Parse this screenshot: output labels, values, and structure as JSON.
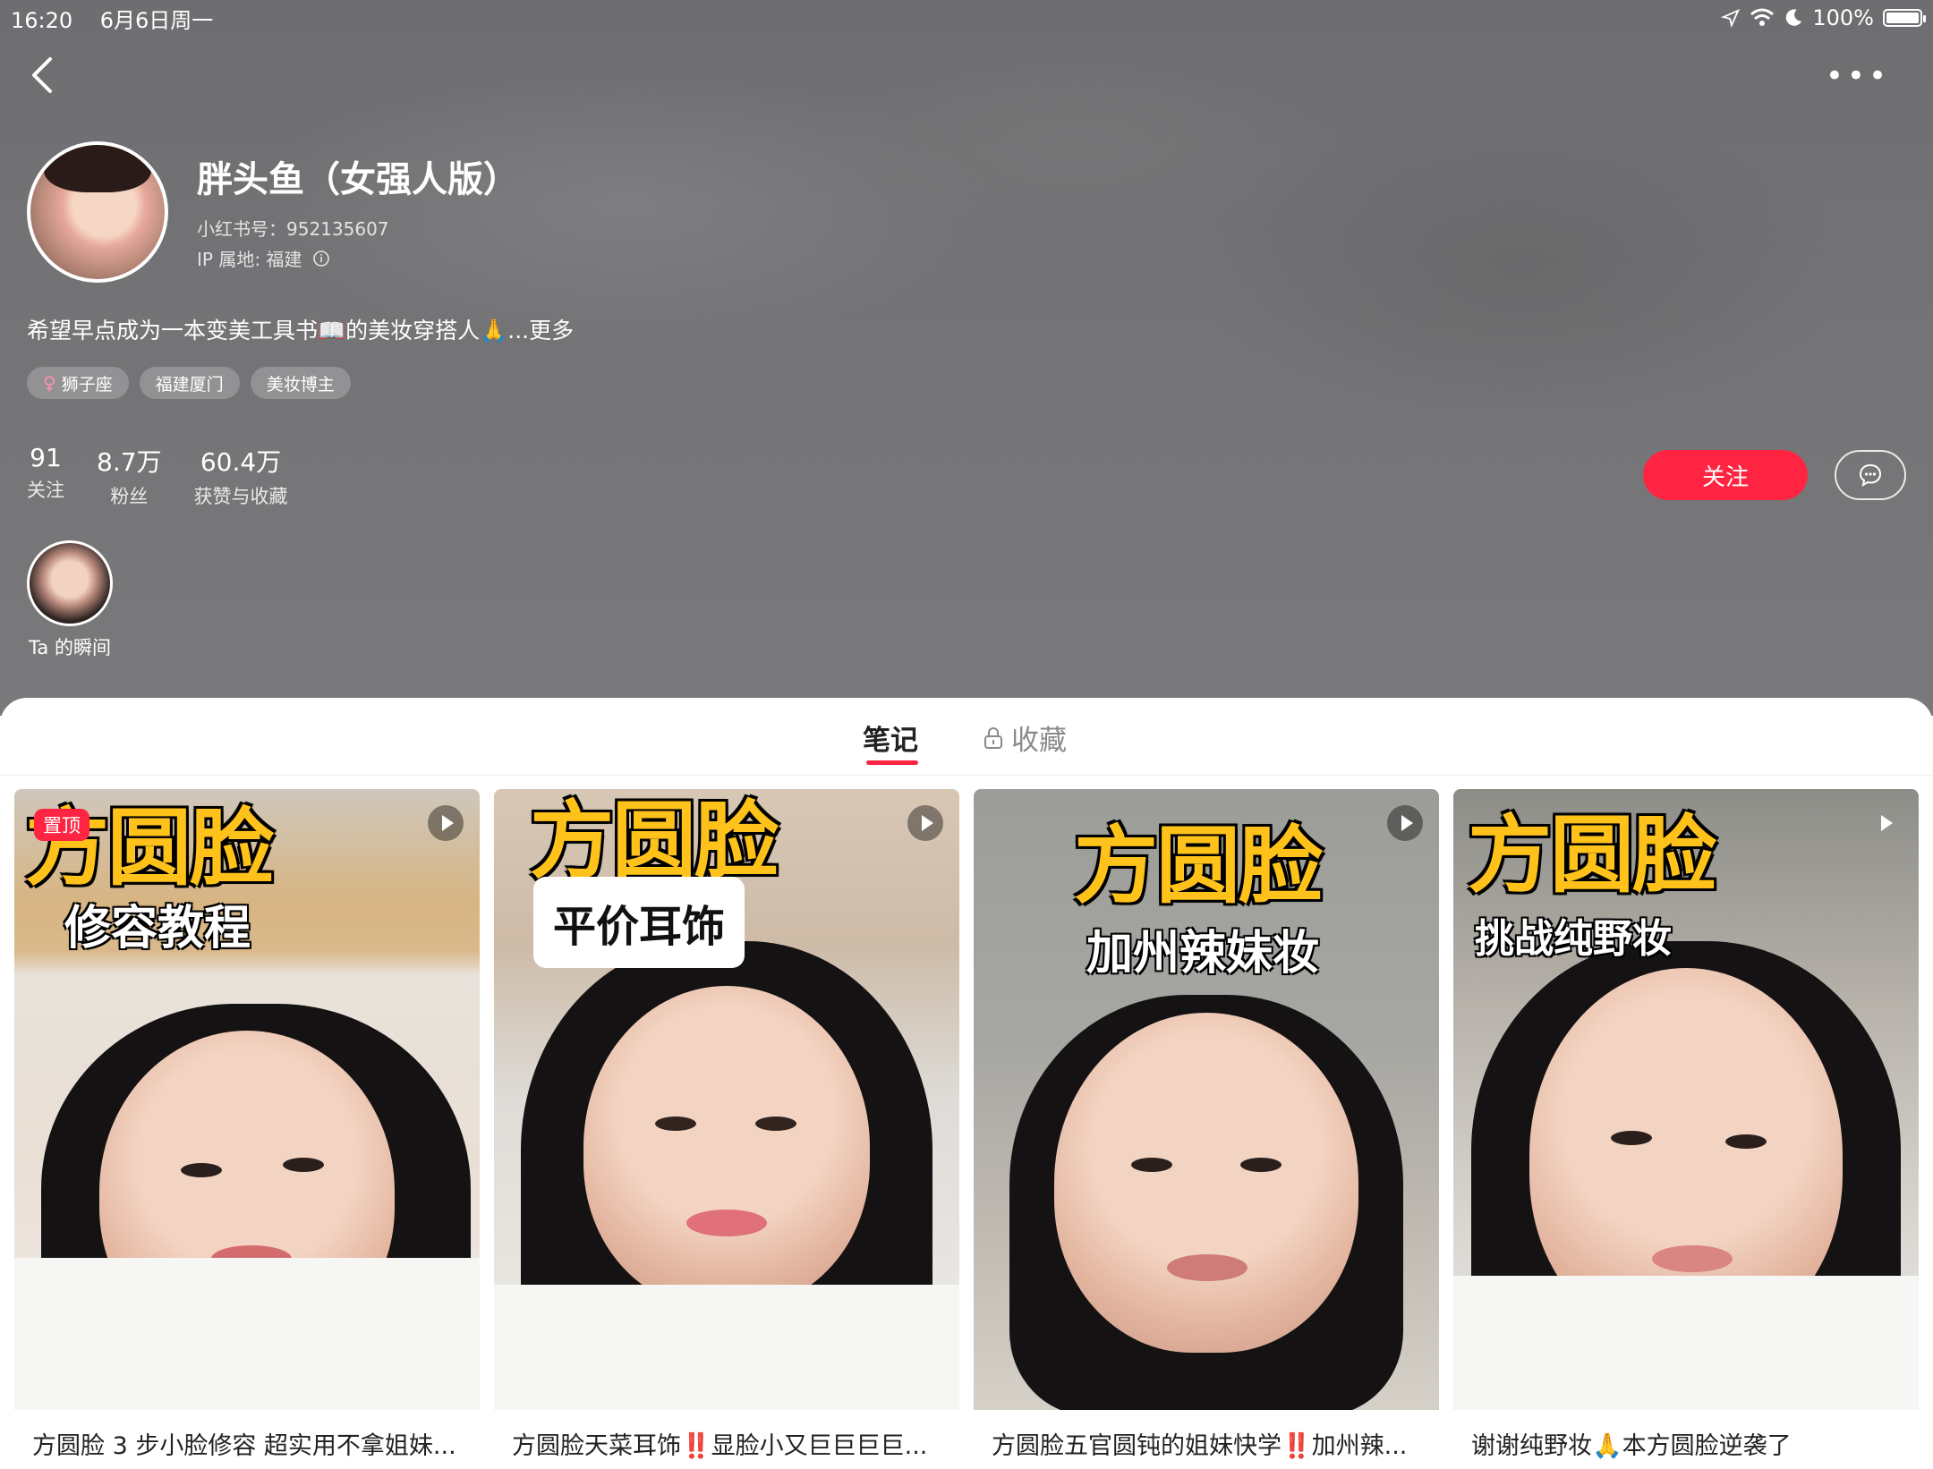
{
  "status_bar": {
    "time": "16:20",
    "date": "6月6日周一",
    "battery": "100%"
  },
  "profile": {
    "name": "胖头鱼（女强人版）",
    "redbook_id": "小红书号：952135607",
    "ip": "IP 属地: 福建",
    "bio": "希望早点成为一本变美工具书📖的美妆穿搭人🙏...更多",
    "tags": [
      "狮子座",
      "福建厦门",
      "美妆博主"
    ],
    "stats": [
      {
        "value": "91",
        "label": "关注"
      },
      {
        "value": "8.7万",
        "label": "粉丝"
      },
      {
        "value": "60.4万",
        "label": "获赞与收藏"
      }
    ],
    "follow_label": "关注",
    "moments_label": "Ta 的瞬间"
  },
  "tabs": {
    "notes": "笔记",
    "collections": "收藏"
  },
  "posts": [
    {
      "pin_label": "置顶",
      "cover_title": "方圆脸",
      "cover_subtitle": "修容教程",
      "caption": "方圆脸 3 步小脸修容 超实用不拿姐妹..."
    },
    {
      "cover_title": "方圆脸",
      "cover_subtitle": "平价耳饰",
      "caption_a": "方圆脸天菜耳饰",
      "caption_mark": "‼️",
      "caption_b": "显脸小又巨巨巨巨..."
    },
    {
      "cover_title": "方圆脸",
      "cover_subtitle": "加州辣妹妆",
      "caption_a": "方圆脸五官圆钝的姐妹快学",
      "caption_mark": "‼️",
      "caption_b": "加州辣..."
    },
    {
      "cover_title": "方圆脸",
      "cover_subtitle": "挑战纯野妆",
      "caption": "谢谢纯野妆🙏本方圆脸逆袭了"
    }
  ]
}
